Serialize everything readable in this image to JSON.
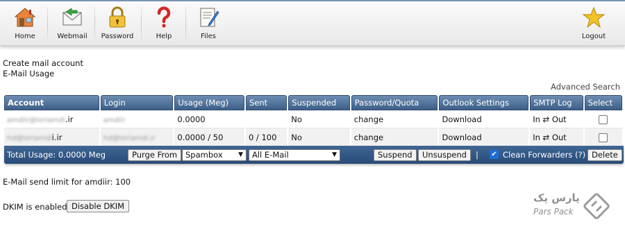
{
  "toolbar": {
    "items": [
      {
        "label": "Home",
        "icon": "home-icon"
      },
      {
        "label": "Webmail",
        "icon": "webmail-icon"
      },
      {
        "label": "Password",
        "icon": "padlock-icon"
      },
      {
        "label": "Help",
        "icon": "question-mark-icon"
      },
      {
        "label": "Files",
        "icon": "files-icon"
      }
    ],
    "logout": {
      "label": "Logout",
      "icon": "star-icon"
    }
  },
  "links": {
    "create_mail_account": "Create mail account",
    "email_usage": "E-Mail Usage",
    "advanced_search": "Advanced Search"
  },
  "table": {
    "headers": [
      "Account",
      "Login",
      "Usage (Meg)",
      "Sent",
      "Suspended",
      "Password/Quota",
      "Outlook Settings",
      "SMTP Log",
      "Select"
    ],
    "rows": [
      {
        "account_blurred": "amdiir@teriamdi",
        "account_suffix": ".ir",
        "login_blurred": "amdiir",
        "usage": "0.0000",
        "sent": "",
        "suspended": "No",
        "password_quota": "change",
        "outlook": "Download",
        "smtp_log": "In ⇄ Out"
      },
      {
        "account_blurred": "hd@teriamdi",
        "account_suffix": "i.ir",
        "login_blurred": "hd@teriamdi.ir",
        "usage": "0.0000 / 50",
        "sent": "0 / 100",
        "suspended": "No",
        "password_quota": "change",
        "outlook": "Download",
        "smtp_log": "In ⇄ Out"
      }
    ]
  },
  "footer_bar": {
    "total_usage": "Total Usage: 0.0000 Meg",
    "purge_from": "Purge From",
    "spambox_select": "Spambox",
    "all_email_select": "All E-Mail",
    "suspend": "Suspend",
    "unsuspend": "Unsuspend",
    "divider": "|",
    "clean_forwarders": "Clean Forwarders (?)",
    "clean_forwarders_checked": true,
    "delete": "Delete"
  },
  "send_limit": "E-Mail send limit for amdiir: 100",
  "dkim": {
    "status_text": "DKIM is enabled",
    "button": "Disable DKIM"
  },
  "watermark": {
    "persian": "پارس پک",
    "english": "Pars Pack"
  },
  "colors": {
    "header_gradient_top": "#6d8db3",
    "header_gradient_bottom": "#3d5f87",
    "footer_bar": "#2f5582",
    "checkbox_blue": "#1b6fd6",
    "toolbar_accent": "#7b93b3"
  }
}
